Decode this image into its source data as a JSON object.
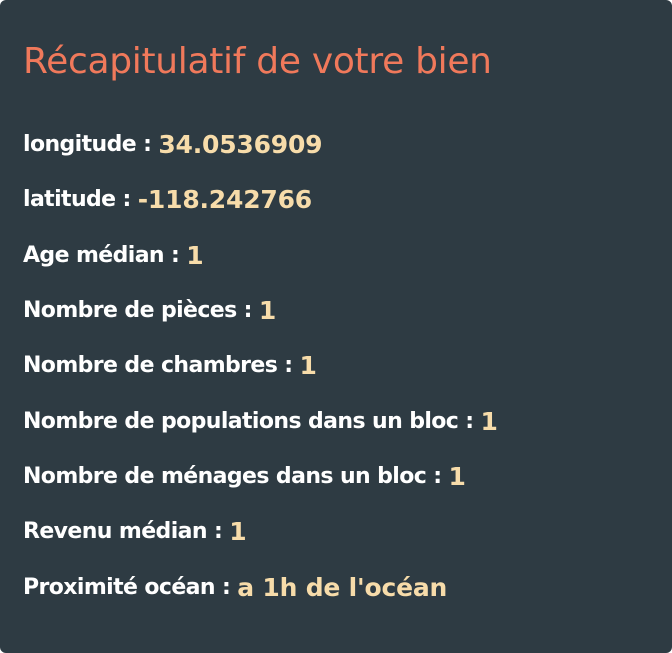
{
  "summary": {
    "title": "Récapitulatif de votre bien",
    "fields": [
      {
        "label": "longitude :",
        "value": "34.0536909"
      },
      {
        "label": "latitude :",
        "value": "-118.242766"
      },
      {
        "label": "Age médian :",
        "value": "1"
      },
      {
        "label": "Nombre de pièces :",
        "value": "1"
      },
      {
        "label": "Nombre de chambres :",
        "value": "1"
      },
      {
        "label": "Nombre de populations dans un bloc :",
        "value": "1"
      },
      {
        "label": "Nombre de ménages dans un bloc :",
        "value": "1"
      },
      {
        "label": "Revenu médian :",
        "value": "1"
      },
      {
        "label": "Proximité océan :",
        "value": "a 1h de l'océan"
      }
    ]
  },
  "colors": {
    "card_background": "#2e3b43",
    "title": "#f0795b",
    "label": "#ffffff",
    "value": "#f7dcaa"
  }
}
